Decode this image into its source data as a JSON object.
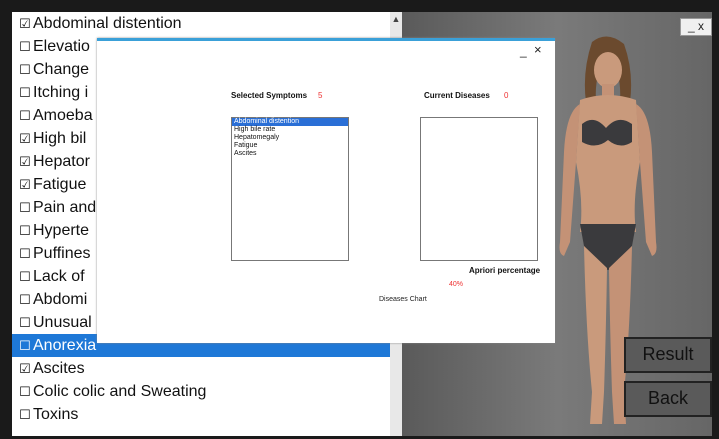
{
  "symptoms": [
    {
      "label": "Abdominal distention",
      "checked": true
    },
    {
      "label": "Elevatio",
      "checked": false
    },
    {
      "label": "Change",
      "checked": false
    },
    {
      "label": "Itching i",
      "checked": false
    },
    {
      "label": "Amoeba",
      "checked": false
    },
    {
      "label": "High bil",
      "checked": true
    },
    {
      "label": "Hepator",
      "checked": true
    },
    {
      "label": "Fatigue",
      "checked": true
    },
    {
      "label": "Pain and",
      "checked": false
    },
    {
      "label": "Hyperte",
      "checked": false
    },
    {
      "label": "Puffines",
      "checked": false
    },
    {
      "label": "Lack of",
      "checked": false
    },
    {
      "label": "Abdomi",
      "checked": false
    },
    {
      "label": "Unusual",
      "checked": false
    },
    {
      "label": "Anorexia",
      "checked": false,
      "selected": true
    },
    {
      "label": "Ascites",
      "checked": true
    },
    {
      "label": "Colic colic and Sweating",
      "checked": false
    },
    {
      "label": "Toxins",
      "checked": false
    }
  ],
  "checkbox_checked": "☑",
  "checkbox_unchecked": "☐",
  "window_controls": "_ x",
  "buttons": {
    "result": "Result",
    "back": "Back"
  },
  "dialog": {
    "minimize": "_",
    "close": "×",
    "selected_symptoms_label": "Selected Symptoms",
    "selected_count": "5",
    "current_diseases_label": "Current Diseases",
    "diseases_count": "0",
    "selected_items": [
      "Abdominal distention",
      "High bile rate",
      "Hepatomegaly",
      "Fatigue",
      "Ascites"
    ],
    "apriori_label": "Apriori percentage",
    "apriori_value": "40%",
    "chart_label": "Diseases Chart"
  },
  "colors": {
    "selection": "#1e78d7",
    "dialog_accent": "#3aa0d8",
    "count": "#e33333"
  }
}
